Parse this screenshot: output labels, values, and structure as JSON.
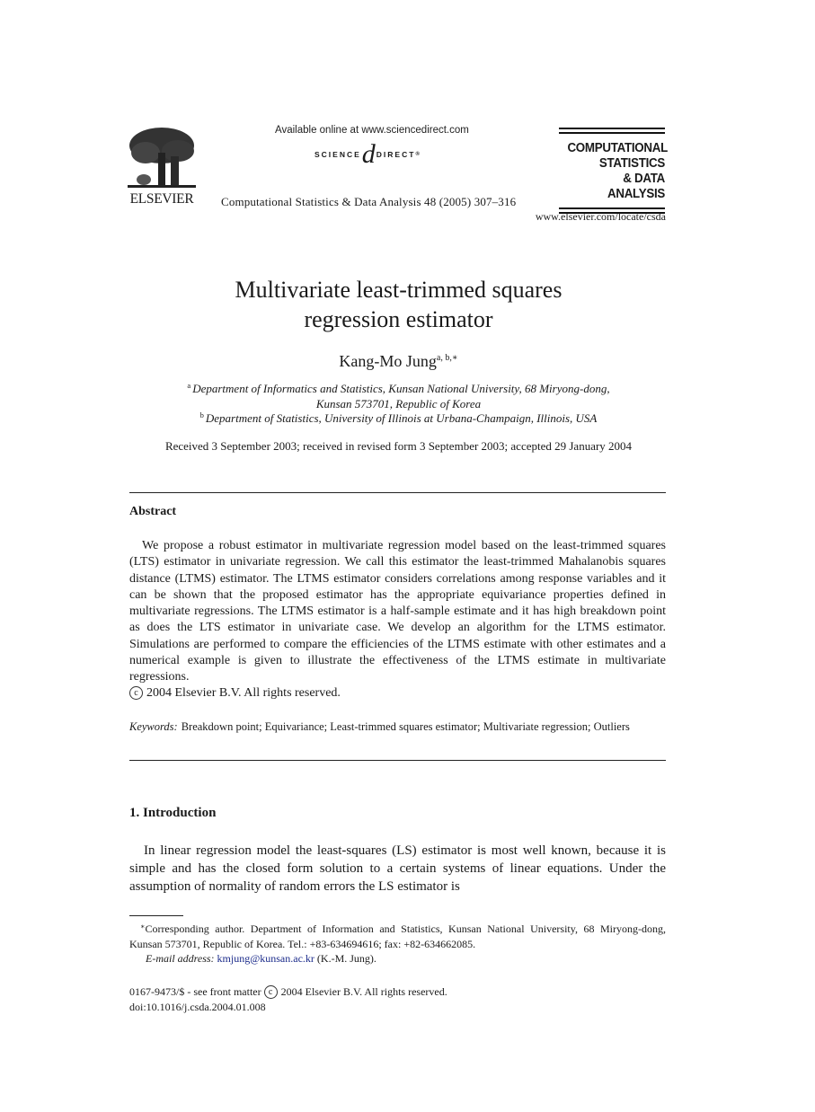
{
  "header": {
    "publisher_logo_text": "ELSEVIER",
    "available_online": "Available online at www.sciencedirect.com",
    "sciencedirect_left": "SCIENCE",
    "sciencedirect_mark": "d",
    "sciencedirect_right": "DIRECT",
    "sciencedirect_reg": "®",
    "journal_citation": "Computational Statistics & Data Analysis 48 (2005) 307–316",
    "journal_logo_lines": [
      "COMPUTATIONAL",
      "STATISTICS",
      "& DATA ANALYSIS"
    ],
    "journal_url": "www.elsevier.com/locate/csda"
  },
  "article": {
    "title_lines": [
      "Multivariate least-trimmed squares",
      "regression estimator"
    ],
    "author": "Kang-Mo Jung",
    "author_marks": "a, b,∗",
    "affiliations": [
      {
        "mark": "a",
        "lines": [
          "Department of Informatics and Statistics, Kunsan National University, 68 Miryong-dong,",
          "Kunsan 573701, Republic of Korea"
        ]
      },
      {
        "mark": "b",
        "lines": [
          "Department of Statistics, University of Illinois at Urbana-Champaign, Illinois, USA"
        ]
      }
    ],
    "received": "Received 3 September 2003; received in revised form 3 September 2003; accepted 29 January 2004"
  },
  "abstract": {
    "heading": "Abstract",
    "text": "We propose a robust estimator in multivariate regression model based on the least-trimmed squares (LTS) estimator in univariate regression. We call this estimator the least-trimmed Mahalanobis squares distance (LTMS) estimator. The LTMS estimator considers correlations among response variables and it can be shown that the proposed estimator has the appropriate equivariance properties defined in multivariate regressions. The LTMS estimator is a half-sample estimate and it has high breakdown point as does the LTS estimator in univariate case. We develop an algorithm for the LTMS estimator. Simulations are performed to compare the effi­ciencies of the LTMS estimate with other estimates and a numerical example is given to illustrate the effectiveness of the LTMS estimate in multivariate regressions.",
    "copyright_symbol": "c",
    "copyright": "2004 Elsevier B.V. All rights reserved.",
    "keywords_label": "Keywords:",
    "keywords": "Breakdown point; Equivariance; Least-trimmed squares estimator; Multivariate regression; Outliers"
  },
  "section1": {
    "heading": "1.  Introduction",
    "text": "In linear regression model the least-squares (LS) estimator is most well known, because it is simple and has the closed form solution to a certain systems of linear equations. Under the assumption of normality of random errors the LS estimator is"
  },
  "footnote": {
    "mark": "∗",
    "corresponding": "Corresponding author. Department of Information and Statistics, Kunsan National University, 68 Miryong-dong, Kunsan 573701, Republic of Korea. Tel.: +83-634694616; fax: +82-634662085.",
    "email_label": "E-mail address:",
    "email": "kmjung@kunsan.ac.kr",
    "email_suffix": "(K.-M. Jung)."
  },
  "front_matter": {
    "issn_prefix": "0167-9473/$ - see front matter",
    "copyright_symbol": "c",
    "copyright": "2004 Elsevier B.V. All rights reserved.",
    "doi": "doi:10.1016/j.csda.2004.01.008"
  }
}
